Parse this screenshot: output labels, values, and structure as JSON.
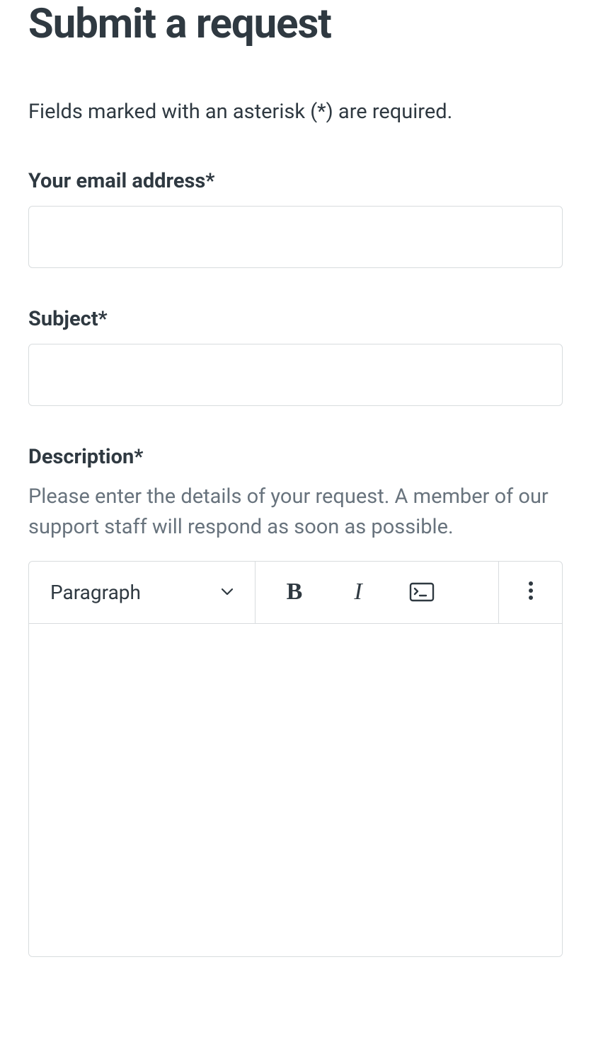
{
  "page": {
    "title": "Submit a request",
    "required_note": "Fields marked with an asterisk (*) are required."
  },
  "form": {
    "email": {
      "label": "Your email address*",
      "value": ""
    },
    "subject": {
      "label": "Subject*",
      "value": ""
    },
    "description": {
      "label": "Description*",
      "hint": "Please enter the details of your request. A member of our support staff will respond as soon as possible.",
      "value": ""
    }
  },
  "editor": {
    "format_label": "Paragraph"
  }
}
